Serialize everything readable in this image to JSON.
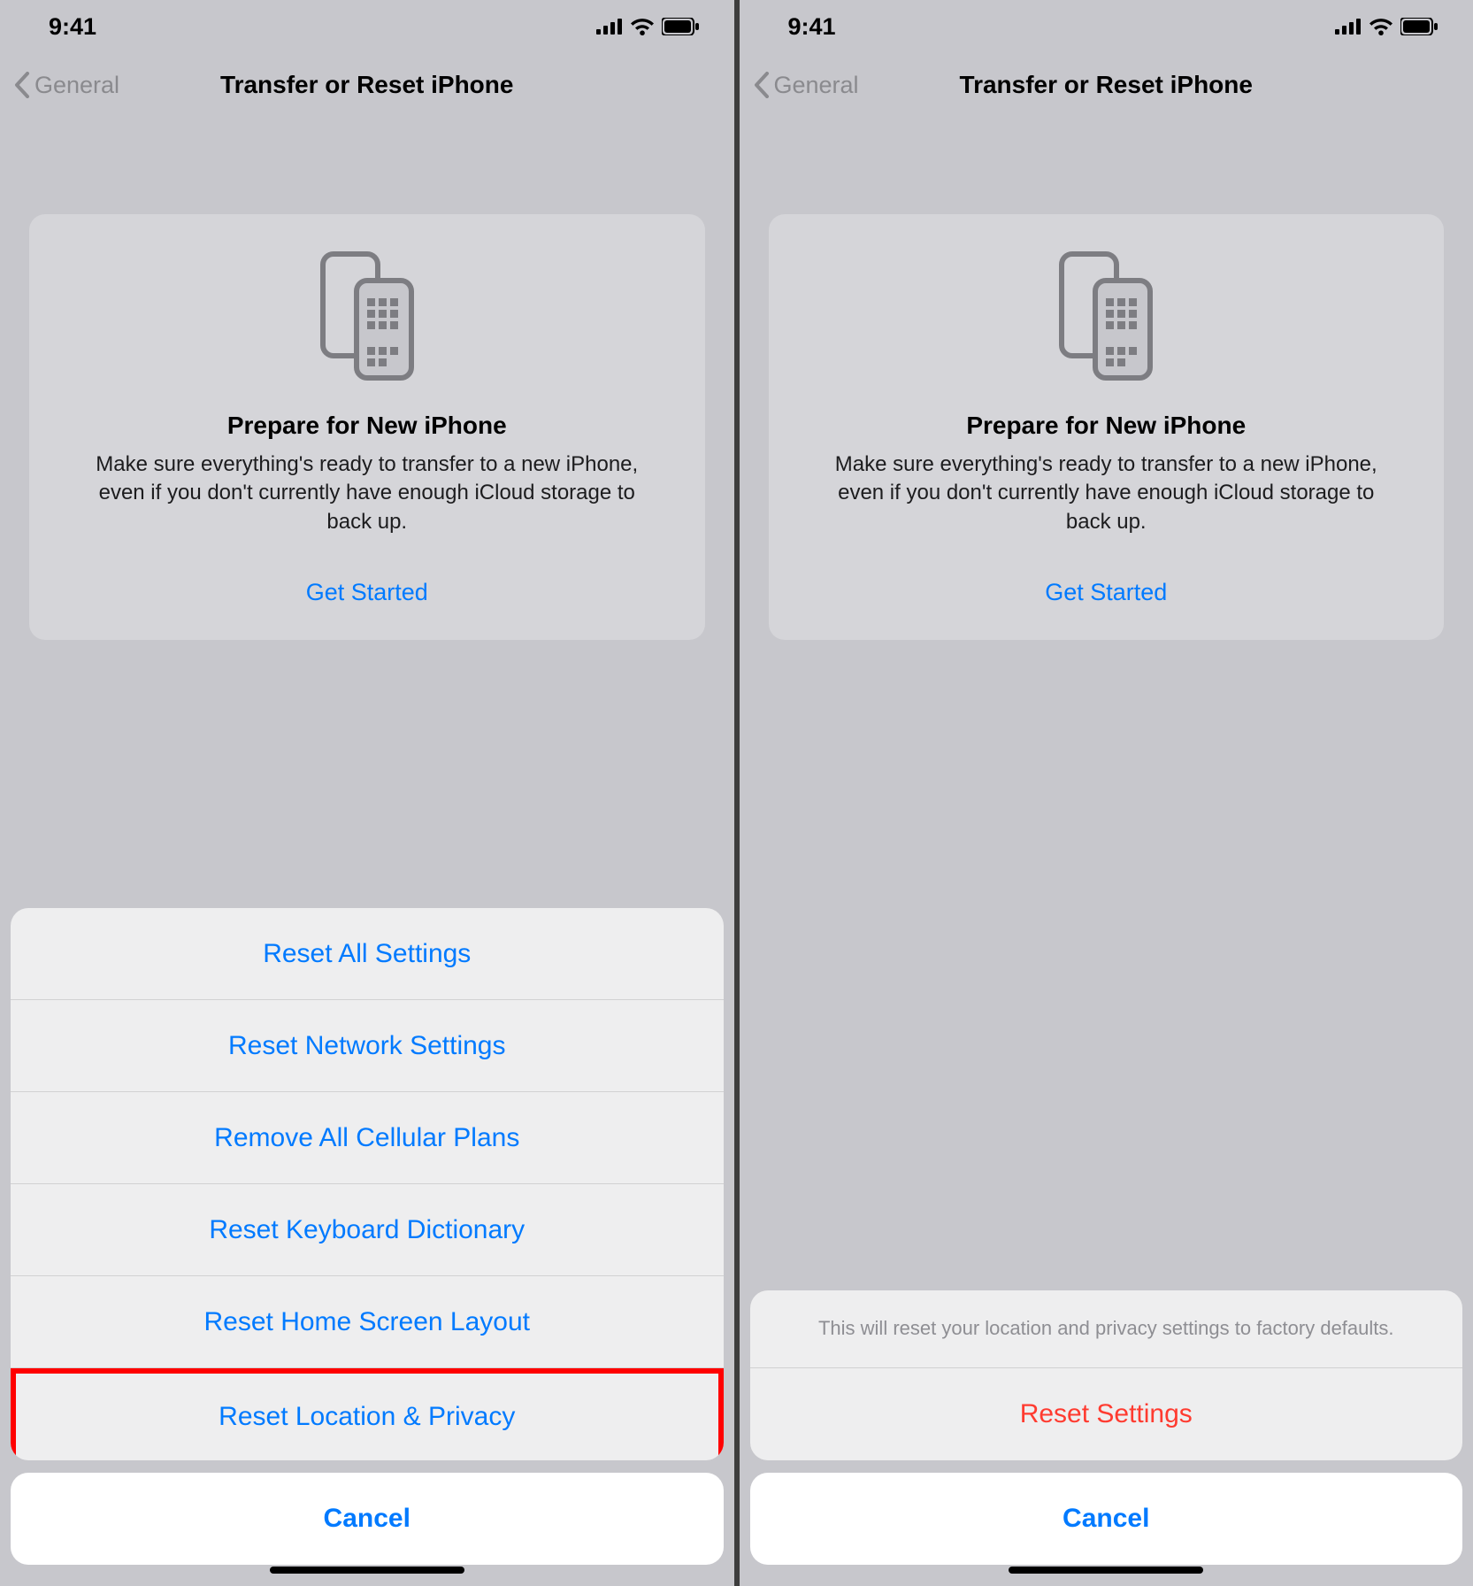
{
  "statusbar": {
    "time": "9:41"
  },
  "navbar": {
    "back_label": "General",
    "title": "Transfer or Reset iPhone"
  },
  "card": {
    "title": "Prepare for New iPhone",
    "desc": "Make sure everything's ready to transfer to a new iPhone, even if you don't currently have enough iCloud storage to back up.",
    "link": "Get Started"
  },
  "sheet_left": {
    "options": [
      "Reset All Settings",
      "Reset Network Settings",
      "Remove All Cellular Plans",
      "Reset Keyboard Dictionary",
      "Reset Home Screen Layout",
      "Reset Location & Privacy"
    ],
    "highlight_index": 5,
    "cancel": "Cancel"
  },
  "sheet_right": {
    "message": "This will reset your location and privacy settings to factory defaults.",
    "action": "Reset Settings",
    "cancel": "Cancel"
  }
}
